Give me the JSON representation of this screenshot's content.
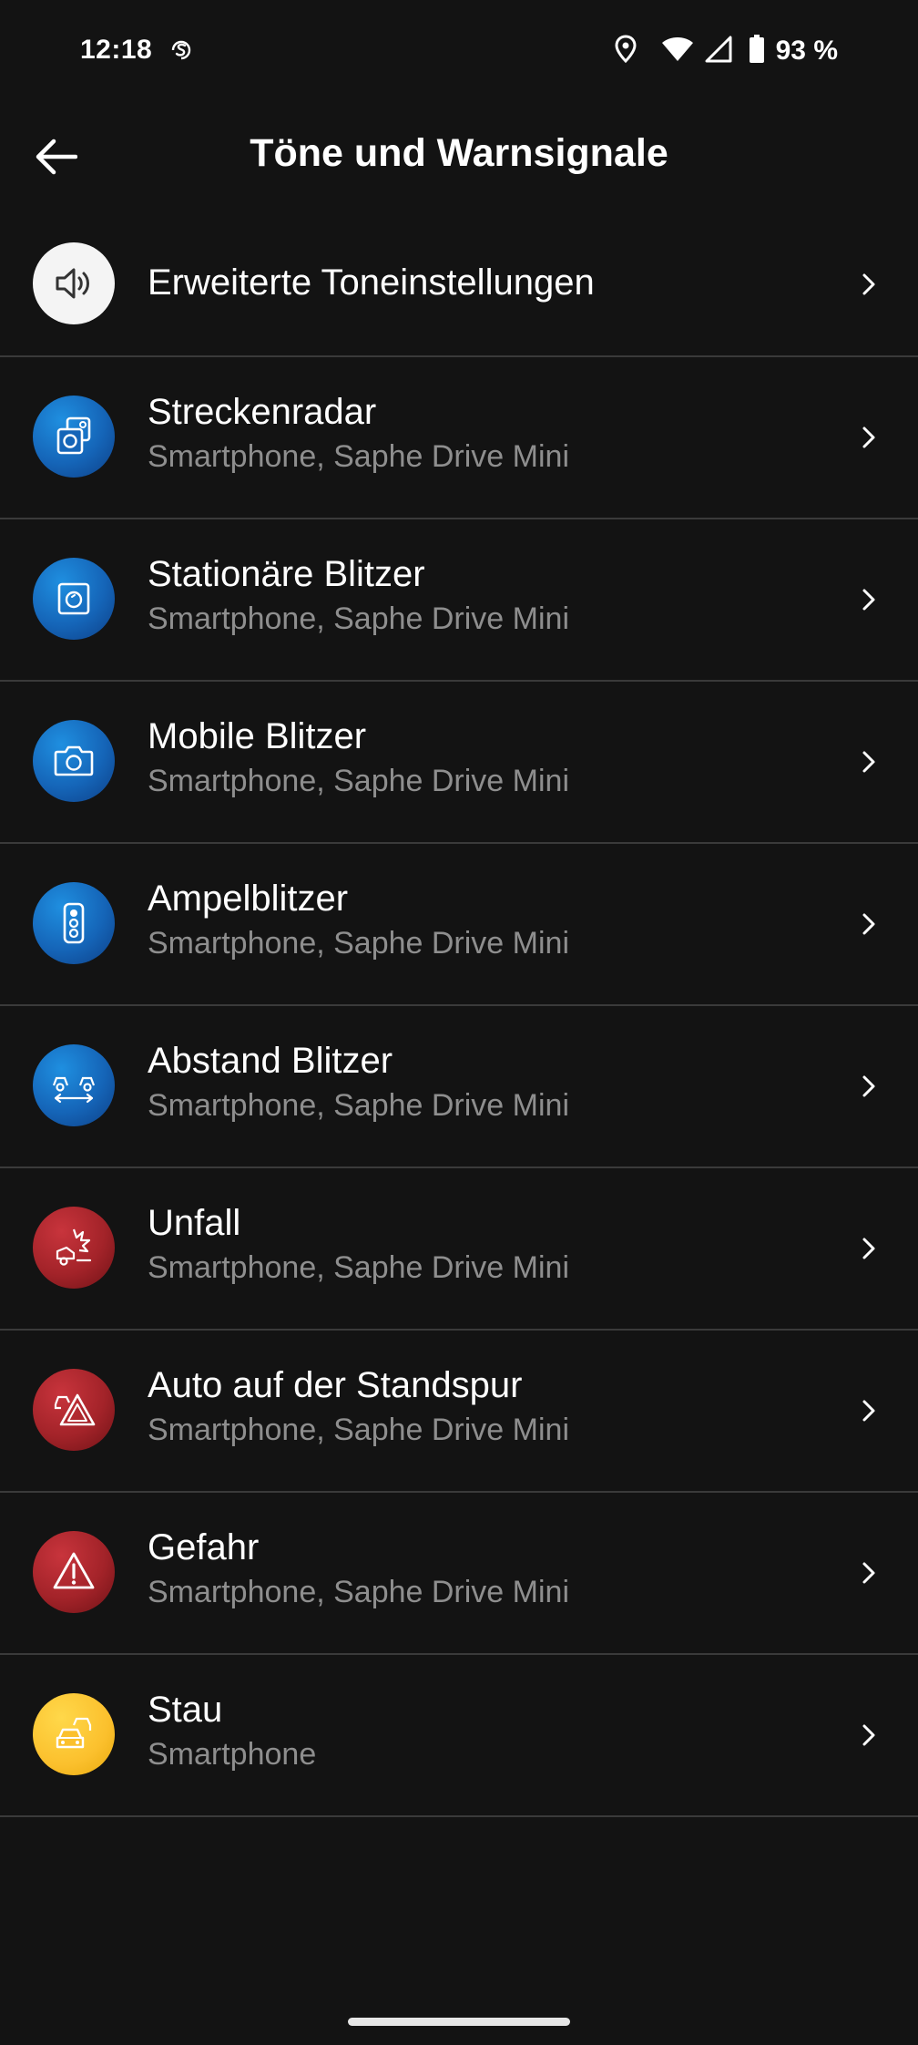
{
  "status_bar": {
    "time": "12:18",
    "app_icon": "s-circle-icon",
    "icons": [
      "location-icon",
      "wifi-icon",
      "signal-icon",
      "battery-icon"
    ],
    "battery_text": "93 %"
  },
  "app_bar": {
    "back_icon": "arrow-left-icon",
    "title": "Töne und Warnsignale"
  },
  "list": {
    "items": [
      {
        "title": "Erweiterte Toneinstellungen",
        "subtitle": "",
        "icon": "speaker-icon",
        "icon_color": "#f4f4f4"
      },
      {
        "title": "Streckenradar",
        "subtitle": "Smartphone, Saphe Drive Mini",
        "icon": "section-radar-icon",
        "icon_color": "#1565b8"
      },
      {
        "title": "Stationäre Blitzer",
        "subtitle": "Smartphone, Saphe Drive Mini",
        "icon": "fixed-camera-icon",
        "icon_color": "#1565b8"
      },
      {
        "title": "Mobile Blitzer",
        "subtitle": "Smartphone, Saphe Drive Mini",
        "icon": "mobile-camera-icon",
        "icon_color": "#1565b8"
      },
      {
        "title": "Ampelblitzer",
        "subtitle": "Smartphone, Saphe Drive Mini",
        "icon": "traffic-light-icon",
        "icon_color": "#1565b8"
      },
      {
        "title": "Abstand Blitzer",
        "subtitle": "Smartphone, Saphe Drive Mini",
        "icon": "distance-camera-icon",
        "icon_color": "#1565b8"
      },
      {
        "title": "Unfall",
        "subtitle": "Smartphone, Saphe Drive Mini",
        "icon": "accident-icon",
        "icon_color": "#a32329"
      },
      {
        "title": "Auto auf der Standspur",
        "subtitle": "Smartphone, Saphe Drive Mini",
        "icon": "breakdown-triangle-icon",
        "icon_color": "#a32329"
      },
      {
        "title": "Gefahr",
        "subtitle": "Smartphone, Saphe Drive Mini",
        "icon": "warning-icon",
        "icon_color": "#a32329"
      },
      {
        "title": "Stau",
        "subtitle": "Smartphone",
        "icon": "traffic-jam-icon",
        "icon_color": "#fbc02d"
      }
    ]
  },
  "colors": {
    "background": "#131313",
    "divider": "#3a3a3a",
    "subtitle": "#8e8e8e",
    "blue": "#1565b8",
    "red": "#a32329",
    "yellow": "#fbc02d"
  }
}
